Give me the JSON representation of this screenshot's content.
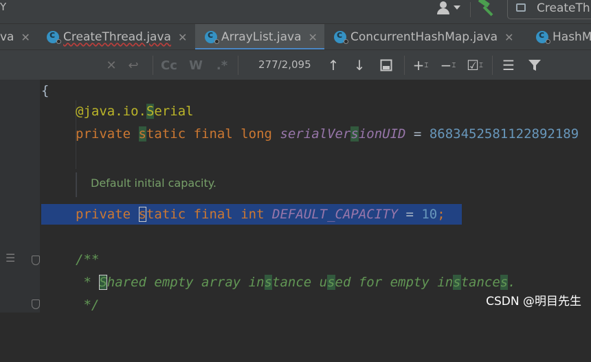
{
  "window": {
    "title_fragment": "Y",
    "run_config_label": "CreateTh"
  },
  "tabs": [
    {
      "label": "va",
      "icon": "",
      "active": false
    },
    {
      "label": "CreateThread.java",
      "icon": "java-class-icon",
      "active": false
    },
    {
      "label": "ArrayList.java",
      "icon": "java-class-icon",
      "active": true
    },
    {
      "label": "ConcurrentHashMap.java",
      "icon": "java-class-icon",
      "active": false
    },
    {
      "label": "HashM",
      "icon": "java-class-icon",
      "active": false
    }
  ],
  "find_bar": {
    "match_count": "277/2,095",
    "match_case_label": "Cc",
    "words_label": "W",
    "regex_label": ".*"
  },
  "code": {
    "line1_brace": "{",
    "line2": {
      "at": "@",
      "ann": "java.io.",
      "ann_hl": "S",
      "ann_rest": "erial"
    },
    "line3": {
      "kw1": "private ",
      "hl1": "s",
      "kw2": "tatic final long ",
      "field_a": "serialVer",
      "field_hl": "s",
      "field_b": "ionUID",
      "eq": " = ",
      "num": "8683452581122892189"
    },
    "doc_comment": "Default initial capacity.",
    "line5": {
      "kw1": "private ",
      "hl1": "s",
      "kw2": "tatic final int ",
      "field": "DEFAULT_CAPACITY",
      "eq": " = ",
      "num": "10",
      "semi": ";"
    },
    "line7": "/**",
    "line8": {
      "star": " * ",
      "hl1": "S",
      "t1": "hared empty array in",
      "hl2": "s",
      "t2": "tance u",
      "hl3": "s",
      "t3": "ed for empty in",
      "hl4": "s",
      "t4": "tance",
      "hl5": "s",
      "t5": "."
    },
    "line9": " */"
  },
  "watermark": "CSDN @明目先生",
  "colors": {
    "keyword": "#cc7832",
    "annotation": "#bbb529",
    "field": "#9876aa",
    "number": "#6897bb",
    "comment": "#629755",
    "selection": "#214283",
    "search_match": "#32593d",
    "tab_underline": "#4a88c7"
  }
}
